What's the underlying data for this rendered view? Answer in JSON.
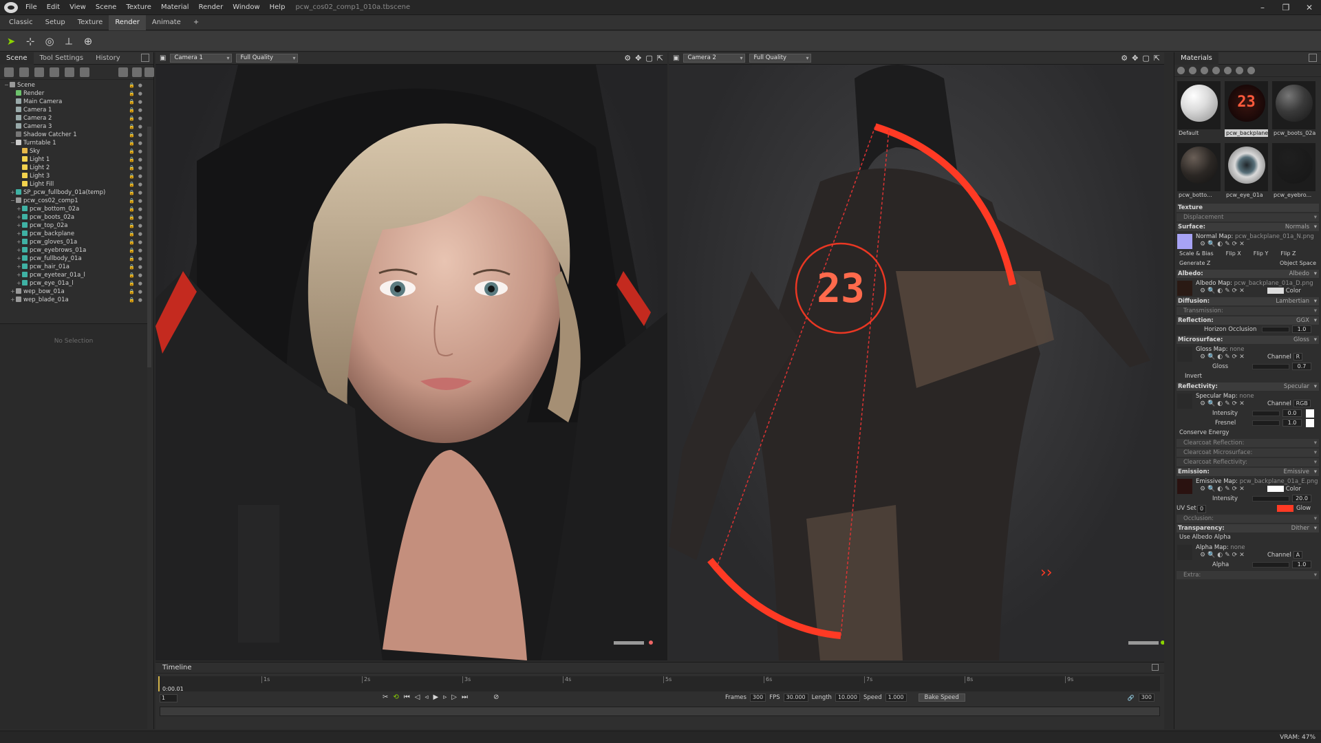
{
  "menu": {
    "items": [
      "File",
      "Edit",
      "View",
      "Scene",
      "Texture",
      "Material",
      "Render",
      "Window",
      "Help"
    ],
    "doc_title": "pcw_cos02_comp1_010a.tbscene"
  },
  "window_controls": {
    "minimize": "–",
    "maximize": "❐",
    "close": "✕"
  },
  "workspace_tabs": [
    "Classic",
    "Setup",
    "Texture",
    "Render",
    "Animate",
    "+"
  ],
  "left_panel": {
    "tabs": [
      "Scene",
      "Tool Settings",
      "History"
    ],
    "no_selection": "No Selection",
    "tree": [
      {
        "label": "Scene",
        "depth": 0,
        "icon": "scene",
        "exp": "−"
      },
      {
        "label": "Render",
        "depth": 1,
        "icon": "render",
        "exp": ""
      },
      {
        "label": "Main Camera",
        "depth": 1,
        "icon": "camera",
        "exp": ""
      },
      {
        "label": "Camera 1",
        "depth": 1,
        "icon": "camera",
        "exp": ""
      },
      {
        "label": "Camera 2",
        "depth": 1,
        "icon": "camera",
        "exp": ""
      },
      {
        "label": "Camera 3",
        "depth": 1,
        "icon": "camera",
        "exp": ""
      },
      {
        "label": "Shadow Catcher 1",
        "depth": 1,
        "icon": "shadow",
        "exp": ""
      },
      {
        "label": "Turntable 1",
        "depth": 1,
        "icon": "turntable",
        "exp": "−"
      },
      {
        "label": "Sky",
        "depth": 2,
        "icon": "sky",
        "exp": ""
      },
      {
        "label": "Light 1",
        "depth": 2,
        "icon": "light",
        "exp": ""
      },
      {
        "label": "Light 2",
        "depth": 2,
        "icon": "light",
        "exp": ""
      },
      {
        "label": "Light 3",
        "depth": 2,
        "icon": "light",
        "exp": ""
      },
      {
        "label": "Light Fill",
        "depth": 2,
        "icon": "light",
        "exp": ""
      },
      {
        "label": "SP_pcw_fullbody_01a(temp)",
        "depth": 1,
        "icon": "mesh",
        "exp": "+"
      },
      {
        "label": "pcw_cos02_comp1",
        "depth": 1,
        "icon": "group",
        "exp": "−"
      },
      {
        "label": "pcw_bottom_02a",
        "depth": 2,
        "icon": "mesh",
        "exp": "+"
      },
      {
        "label": "pcw_boots_02a",
        "depth": 2,
        "icon": "mesh",
        "exp": "+"
      },
      {
        "label": "pcw_top_02a",
        "depth": 2,
        "icon": "mesh",
        "exp": "+"
      },
      {
        "label": "pcw_backplane",
        "depth": 2,
        "icon": "mesh",
        "exp": "+"
      },
      {
        "label": "pcw_gloves_01a",
        "depth": 2,
        "icon": "mesh",
        "exp": "+"
      },
      {
        "label": "pcw_eyebrows_01a",
        "depth": 2,
        "icon": "mesh",
        "exp": "+"
      },
      {
        "label": "pcw_fullbody_01a",
        "depth": 2,
        "icon": "mesh",
        "exp": "+"
      },
      {
        "label": "pcw_hair_01a",
        "depth": 2,
        "icon": "mesh",
        "exp": "+"
      },
      {
        "label": "pcw_eyetear_01a_l",
        "depth": 2,
        "icon": "mesh",
        "exp": "+"
      },
      {
        "label": "pcw_eye_01a_l",
        "depth": 2,
        "icon": "mesh",
        "exp": "+"
      },
      {
        "label": "wep_bow_01a",
        "depth": 1,
        "icon": "group",
        "exp": "+"
      },
      {
        "label": "wep_blade_01a",
        "depth": 1,
        "icon": "group",
        "exp": "+"
      }
    ]
  },
  "viewport1": {
    "camera": "Camera 1",
    "quality": "Full Quality"
  },
  "viewport2": {
    "camera": "Camera 2",
    "quality": "Full Quality",
    "hud_number": "23"
  },
  "materials": {
    "title": "Materials",
    "thumbs": [
      {
        "name": "Default",
        "style": "default"
      },
      {
        "name": "pcw_backplane",
        "style": "backplane",
        "selected": true
      },
      {
        "name": "pcw_boots_02a",
        "style": "boots"
      },
      {
        "name": "pcw_botto...",
        "style": "bottom"
      },
      {
        "name": "pcw_eye_01a",
        "style": "eye"
      },
      {
        "name": "pcw_eyebro...",
        "style": "dark"
      }
    ],
    "texture_label": "Texture",
    "displacement_label": "Displacement",
    "surface": {
      "label": "Surface:",
      "mode": "Normals",
      "normal_map_label": "Normal Map:",
      "normal_map_file": "pcw_backplane_01a_N.png",
      "scale_bias": "Scale & Bias",
      "flip_x": "Flip X",
      "flip_y": "Flip Y",
      "flip_z": "Flip Z",
      "generate_z": "Generate Z",
      "object_space": "Object Space"
    },
    "albedo": {
      "label": "Albedo:",
      "mode": "Albedo",
      "map_label": "Albedo Map:",
      "map_file": "pcw_backplane_01a_D.png",
      "color": "Color"
    },
    "diffusion": {
      "label": "Diffusion:",
      "mode": "Lambertian"
    },
    "transmission_label": "Transmission:",
    "reflection": {
      "label": "Reflection:",
      "mode": "GGX",
      "horizon": "Horizon Occlusion",
      "horizon_val": "1.0"
    },
    "microsurface": {
      "label": "Microsurface:",
      "mode": "Gloss",
      "map_label": "Gloss Map:",
      "map_file": "none",
      "channel": "Channel",
      "channel_val": "R",
      "gloss": "Gloss",
      "gloss_val": "0.7",
      "invert": "Invert"
    },
    "reflectivity": {
      "label": "Reflectivity:",
      "mode": "Specular",
      "map_label": "Specular Map:",
      "map_file": "none",
      "channel": "Channel",
      "channel_val": "RGB",
      "intensity": "Intensity",
      "intensity_val": "0.0",
      "fresnel": "Fresnel",
      "fresnel_val": "1.0",
      "conserve": "Conserve Energy"
    },
    "clearcoat_reflection": "Clearcoat Reflection:",
    "clearcoat_microsurface": "Clearcoat Microsurface:",
    "clearcoat_reflectivity": "Clearcoat Reflectivity:",
    "emission": {
      "label": "Emission:",
      "mode": "Emissive",
      "map_label": "Emissive Map:",
      "map_file": "pcw_backplane_01a_E.png",
      "color": "Color",
      "intensity": "Intensity",
      "intensity_val": "20.0",
      "uvset": "UV Set",
      "uvset_val": "0",
      "glow": "Glow"
    },
    "occlusion_label": "Occlusion:",
    "transparency": {
      "label": "Transparency:",
      "mode": "Dither",
      "use_albedo_alpha": "Use Albedo Alpha",
      "map_label": "Alpha Map:",
      "map_file": "none",
      "channel": "Channel",
      "channel_val": "A",
      "alpha": "Alpha",
      "alpha_val": "1.0"
    },
    "extra_label": "Extra:"
  },
  "timeline": {
    "title": "Timeline",
    "ticks": [
      "1s",
      "2s",
      "3s",
      "4s",
      "5s",
      "6s",
      "7s",
      "8s",
      "9s"
    ],
    "current_time": "0:00.01",
    "frame": "1",
    "frames_label": "Frames",
    "frames_val": "300",
    "fps_label": "FPS",
    "fps_val": "30.000",
    "length_label": "Length",
    "length_val": "10.000",
    "speed_label": "Speed",
    "speed_val": "1.000",
    "bake_speed": "Bake Speed",
    "end_frame": "300"
  },
  "status": {
    "vram": "VRAM: 47%"
  },
  "colors": {
    "accent_green": "#8bd400",
    "emissive_red": "#ff3a24",
    "normal_swatch": "#a7a3f5"
  }
}
